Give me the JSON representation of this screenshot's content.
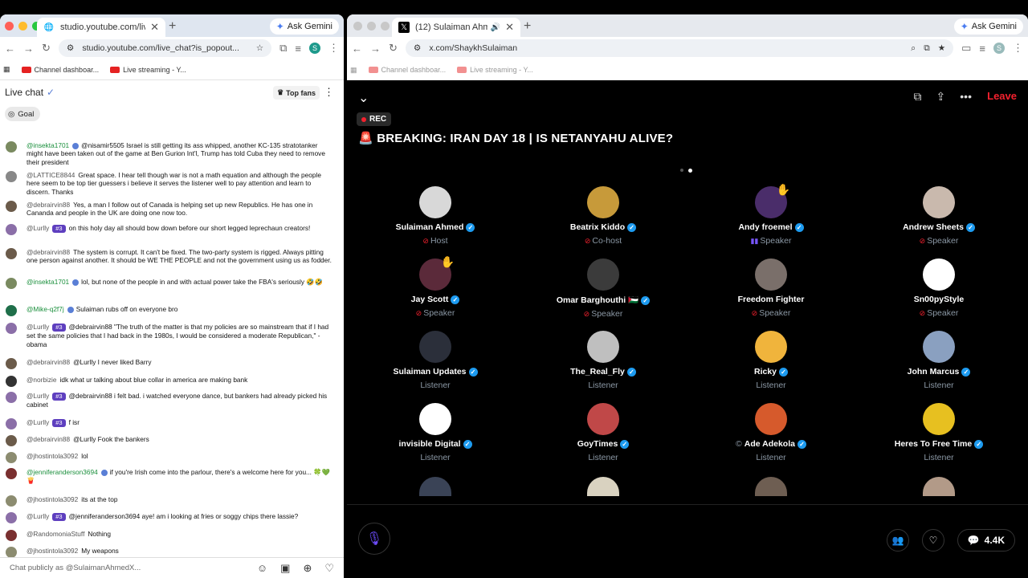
{
  "left": {
    "tab_title": "studio.youtube.com/live_chat",
    "url": "studio.youtube.com/live_chat?is_popout...",
    "ask_gemini": "Ask Gemini",
    "profile_initial": "S",
    "bookmarks": [
      "Channel dashboar...",
      "Live streaming - Y..."
    ],
    "chat_title": "Live chat",
    "top_fans": "Top fans",
    "goal": "Goal",
    "input_placeholder": "Chat publicly as @SulaimanAhmedX...",
    "messages": [
      {
        "author": "@insekta1701",
        "verified": true,
        "color": "green",
        "text": "@nisamir5505 Israel is still getting its ass whipped, another KC-135 stratotanker might have been taken out of the game at Ben Gurion Int'l, Trump has told Cuba they need to remove their president"
      },
      {
        "author": "@LATTICE8844",
        "text": "Great space. I hear tell though war is not a math equation and although the people here seem to be top tier guessers i believe it serves the listener well to pay attention and learn to discern. Thanks"
      },
      {
        "author": "@debrairvin88",
        "text": "Yes, a man I follow out of Canada is helping set up new Republics. He has one in Cananda and people in the UK are doing one now too."
      },
      {
        "author": "@Lurlly",
        "badge": "#3",
        "text": "on this holy day all should bow down before our short legged leprechaun creators!"
      },
      {
        "author": "@debrairvin88",
        "text": "The system is corrupt. It can't be fixed. The two-party system is rigged. Always pitting one person against another. It should be WE THE PEOPLE and not the government using us as fodder."
      },
      {
        "author": "@insekta1701",
        "verified": true,
        "color": "green",
        "text": "lol, but none of the people in and with actual power take the FBA's seriously 🤣🤣"
      },
      {
        "author": "@Mike-q2f7j",
        "verified": true,
        "color": "green",
        "text": "Sulaiman rubs off on everyone bro"
      },
      {
        "author": "@Lurlly",
        "badge": "#3",
        "text": "@debrairvin88 \"The truth of the matter is that my policies are so mainstream that if I had set the same policies that I had back in the 1980s, I would be considered a moderate Republican,\" -obama"
      },
      {
        "author": "@debrairvin88",
        "text": "@Lurlly I never liked Barry"
      },
      {
        "author": "@norbizie",
        "text": "idk what ur talking about blue collar in america are making bank"
      },
      {
        "author": "@Lurlly",
        "badge": "#3",
        "text": "@debrairvin88 i felt bad. i watched everyone dance, but bankers had already picked his cabinet"
      },
      {
        "author": "@Lurlly",
        "badge": "#3",
        "text": "f isr"
      },
      {
        "author": "@debrairvin88",
        "text": "@Lurlly Fook the bankers"
      },
      {
        "author": "@jhostintola3092",
        "text": "lol"
      },
      {
        "author": "@jenniferanderson3694",
        "verified": true,
        "color": "green",
        "text": "if you're Irish come into the parlour, there's a welcome here for you... 🍀💚🍟"
      },
      {
        "author": "@jhostintola3092",
        "text": "its at the top"
      },
      {
        "author": "@Lurlly",
        "badge": "#3",
        "text": "@jenniferanderson3694 aye! am i looking at fries or soggy chips there lassie?"
      },
      {
        "author": "@RandomoniaStuff",
        "text": "Nothing"
      },
      {
        "author": "@jhostintola3092",
        "text": "My weapons"
      }
    ]
  },
  "right": {
    "tab_title": "(12) Sulaiman Ahmed (@S",
    "url": "x.com/ShaykhSulaiman",
    "ask_gemini": "Ask Gemini",
    "bookmarks": [
      "Channel dashboar...",
      "Live streaming - Y..."
    ],
    "leave": "Leave",
    "rec": "REC",
    "title": "🚨 BREAKING: IRAN DAY 18 | IS NETANYAHU ALIVE?",
    "participants": [
      {
        "name": "Sulaiman Ahmed",
        "verified": true,
        "role": "Host",
        "mic": "muted"
      },
      {
        "name": "Beatrix Kiddo",
        "verified": true,
        "role": "Co-host",
        "mic": "muted"
      },
      {
        "name": "Andy froemel",
        "verified": true,
        "role": "Speaker",
        "mic": "speaking",
        "hand": true
      },
      {
        "name": "Andrew Sheets",
        "verified": true,
        "role": "Speaker",
        "mic": "muted"
      },
      {
        "name": "Jay Scott",
        "verified": true,
        "role": "Speaker",
        "mic": "muted",
        "hand": true
      },
      {
        "name": "Omar Barghouthi 🇵🇸",
        "verified": true,
        "role": "Speaker",
        "mic": "muted"
      },
      {
        "name": "Freedom Fighter",
        "verified": false,
        "role": "Speaker",
        "mic": "muted"
      },
      {
        "name": "Sn00pyStyle",
        "verified": false,
        "role": "Speaker",
        "mic": "muted"
      },
      {
        "name": "Sulaiman Updates",
        "verified": true,
        "role": "Listener"
      },
      {
        "name": "The_Real_Fly",
        "verified": true,
        "role": "Listener"
      },
      {
        "name": "Ricky",
        "verified": true,
        "role": "Listener"
      },
      {
        "name": "John Marcus",
        "verified": true,
        "role": "Listener"
      },
      {
        "name": "invisible Digital",
        "verified": true,
        "role": "Listener"
      },
      {
        "name": "GoyTimes",
        "verified": true,
        "role": "Listener"
      },
      {
        "name": "Ade Adekola",
        "verified": true,
        "role": "Listener",
        "prefix": "©"
      },
      {
        "name": "Heres To Free Time",
        "verified": true,
        "role": "Listener"
      }
    ],
    "reply_count": "4.4K"
  },
  "colors": {
    "accent_x": "#1d9bf0",
    "leave": "#f4212e",
    "yt_purple": "#5e3fbf"
  }
}
